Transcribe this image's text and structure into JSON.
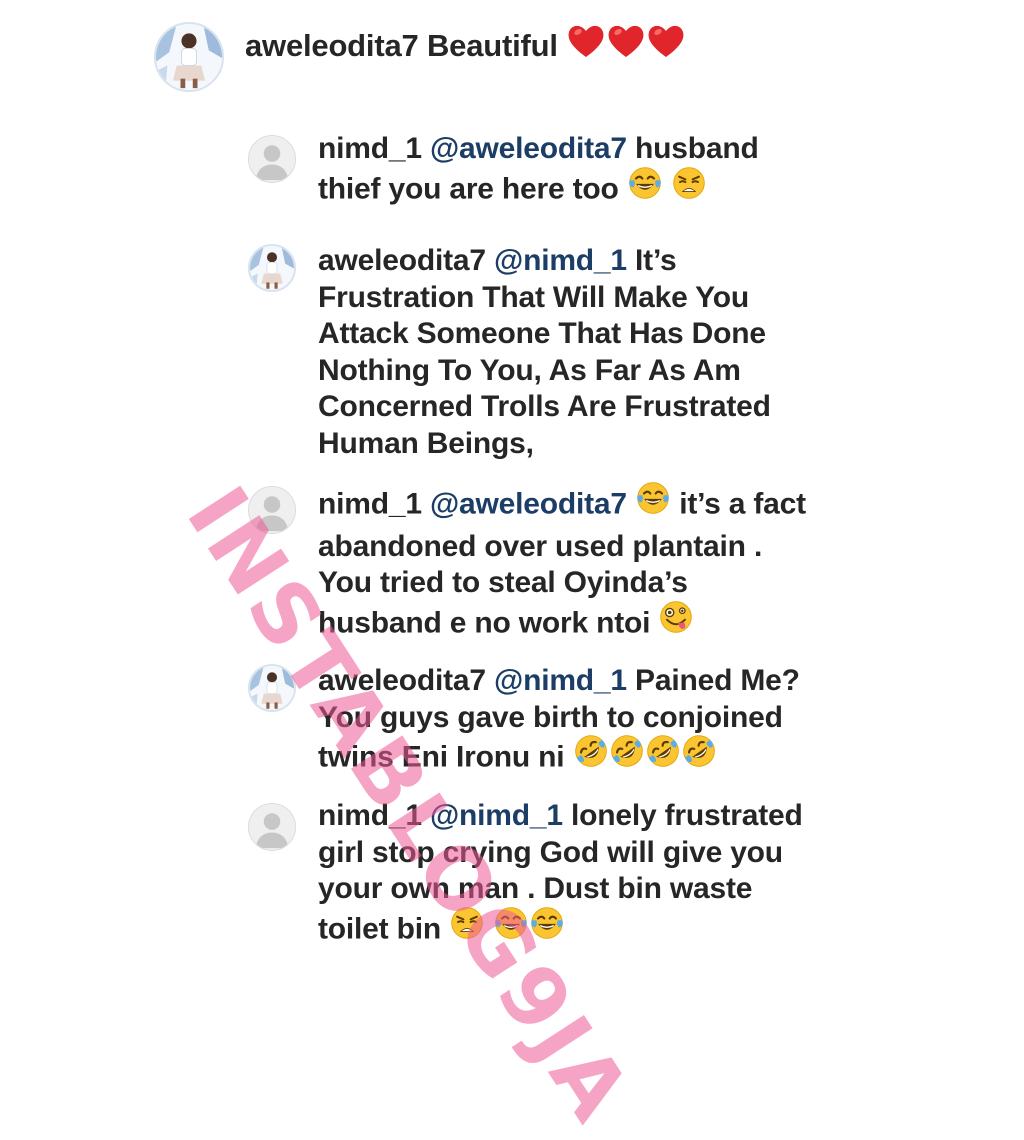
{
  "comments": [
    {
      "username": "aweleodita7",
      "mention": "",
      "lines": [
        "Beautiful"
      ],
      "emojis": [
        "heart",
        "heart",
        "heart"
      ]
    },
    {
      "username": "nimd_1",
      "mention": "@aweleodita7",
      "line1": "husband",
      "line2": "thief you are here too",
      "emojis": [
        "laughing-tears",
        "weary"
      ]
    },
    {
      "username": "aweleodita7",
      "mention": "@nimd_1",
      "line1": "It’s",
      "line2": "Frustration That Will Make You",
      "line3": "Attack Someone That Has Done",
      "line4": "Nothing To You, As Far As Am",
      "line5": "Concerned Trolls Are Frustrated",
      "line6": "Human Beings,"
    },
    {
      "username": "nimd_1",
      "mention": "@aweleodita7",
      "line1": "it’s a fact",
      "line2": "abandoned over used plantain .",
      "line3": "You tried to steal Oyinda’s",
      "line4": "husband e no work ntoi",
      "emojis": [
        "laughing-tears",
        "zany"
      ]
    },
    {
      "username": "aweleodita7",
      "mention": "@nimd_1",
      "line1": "Pained Me?",
      "line2": "You guys gave birth to conjoined",
      "line3": "twins Eni Ironu ni",
      "emojis": [
        "rofl",
        "rofl",
        "rofl",
        "rofl"
      ]
    },
    {
      "username": "nimd_1",
      "mention": "@nimd_1",
      "line1": "lonely frustrated",
      "line2": "girl stop crying God will give you",
      "line3": "your own man . Dust bin waste",
      "line4": "toilet bin",
      "emojis": [
        "weary",
        "laughing-tears",
        "laughing-tears"
      ]
    }
  ],
  "watermark": "INSTABLOG9JA",
  "colors": {
    "text": "#262626",
    "mention": "#1c3d66",
    "watermark": "#ee5a96",
    "heart": "#e0262a",
    "emoji_face": "#fbc531"
  }
}
